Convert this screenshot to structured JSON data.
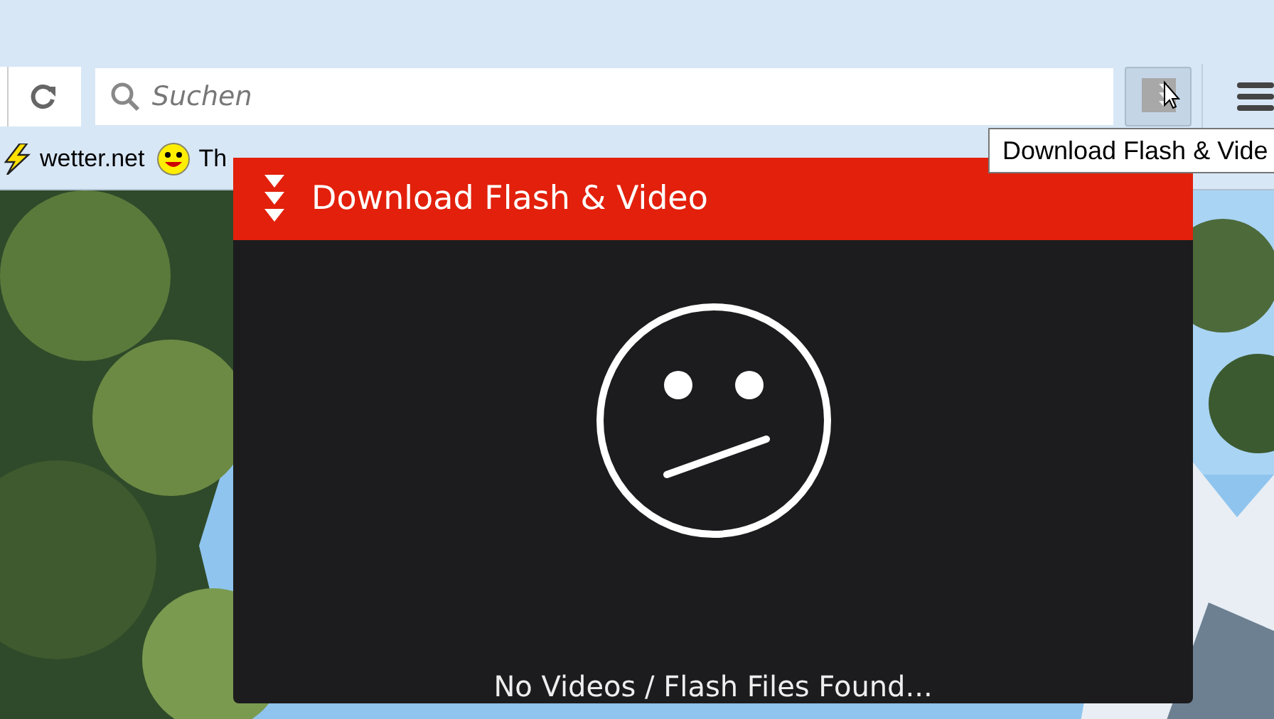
{
  "toolbar": {
    "search": {
      "placeholder": "Suchen"
    }
  },
  "bookmarks": [
    {
      "label": "wetter.net",
      "kind": "bolt"
    },
    {
      "label": "Th",
      "kind": "smiley"
    }
  ],
  "tooltip": "Download Flash & Vide",
  "popup": {
    "title": "Download Flash & Video",
    "message": "No Videos / Flash Files Found..."
  }
}
